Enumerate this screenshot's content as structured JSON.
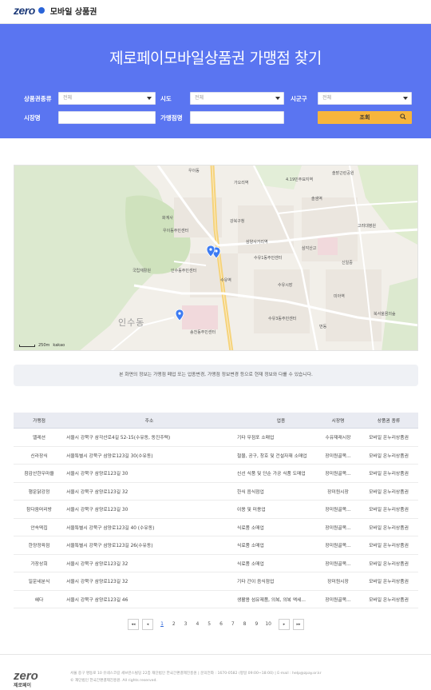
{
  "header": {
    "logo_mark": "zero",
    "logo_text": "모바일 상품권"
  },
  "hero": {
    "title": "제로페이모바일상품권 가맹점 찾기",
    "filters": {
      "voucher_type_label": "상품권종류",
      "voucher_type_value": "전체",
      "sido_label": "시도",
      "sido_value": "전체",
      "sigungu_label": "시군구",
      "sigungu_value": "전체",
      "market_label": "시장명",
      "market_value": "",
      "store_label": "가맹점명",
      "store_value": "",
      "search_label": "조회"
    }
  },
  "map": {
    "district_label": "인수동",
    "scale_label": "250m",
    "provider": "kakao",
    "labels": [
      "우이동",
      "가오리역",
      "4.19민주묘지역",
      "솔밭근린공원",
      "솔샘역",
      "우이동주민센터",
      "수유1동주민센터",
      "수유3동주민센터",
      "삼양사거리역",
      "수유역",
      "미아역",
      "인수동주민센터",
      "송천동주민센터",
      "번동",
      "강북구청",
      "수유시장",
      "고려대병원",
      "삼각산고",
      "신일중",
      "국립재활원",
      "화계사",
      "북서울꿈의숲"
    ]
  },
  "notice": "본 화면의 정보는 가맹점 폐업 또는 업종변경, 가맹점 정보변경 등으로 현재 정보와 다를 수 있습니다.",
  "table": {
    "headers": [
      "가맹점",
      "주소",
      "업종",
      "시장명",
      "상품권 종류"
    ],
    "rows": [
      [
        "엘레션",
        "서울시 강북구 삼각산로4길 52-15(수유동, 동진주택)",
        "기타 무점포 소매업",
        "수유재래시장",
        "모바일 온누리상품권"
      ],
      [
        "신라장식",
        "서울특별시 강북구 삼양로123길 30(수유동)",
        "철물, 공구, 창호 및 건설자재 소매업",
        "장미원골목...",
        "모바일 온누리상품권"
      ],
      [
        "참감산한우마을",
        "서울시 강북구 삼양로123길 30",
        "신선 식품 및 단순 가공 식품 도매업",
        "장미원골목...",
        "모바일 온누리상품권"
      ],
      [
        "행운닭강정",
        "서울시 강북구 삼양로123길 32",
        "한식 음식점업",
        "장미원시장",
        "모바일 온누리상품권"
      ],
      [
        "참다움머리방",
        "서울시 강북구 삼양로123길 30",
        "이용 및 미용업",
        "장미원골목...",
        "모바일 온누리상품권"
      ],
      [
        "안속떡집",
        "서울특별시 강북구 삼양로123길 40 (수유동)",
        "식료품 소매업",
        "장미원골목...",
        "모바일 온누리상품권"
      ],
      [
        "한양정육점",
        "서울특별시 강북구 삼양로123길 26(수유동)",
        "식료품 소매업",
        "장미원골목...",
        "모바일 온누리상품권"
      ],
      [
        "가장상회",
        "서울시 강북구 삼양로123길 32",
        "식료품 소매업",
        "장미원골목...",
        "모바일 온누리상품권"
      ],
      [
        "일운네분식",
        "서울시 강북구 삼양로123길 32",
        "기타 간이 음식점업",
        "장미원시장",
        "모바일 온누리상품권"
      ],
      [
        "혜다",
        "서울시 강북구 삼양로123길 46",
        "생활용 섬유제품, 의복, 의복 액세...",
        "장미원골목...",
        "모바일 온누리상품권"
      ]
    ]
  },
  "pagination": {
    "first": "◂◂",
    "prev": "◂",
    "next": "▸",
    "last": "▸▸",
    "pages": [
      "1",
      "2",
      "3",
      "4",
      "5",
      "6",
      "7",
      "8",
      "9",
      "10"
    ],
    "current": "1"
  },
  "footer": {
    "logo_mark": "zero",
    "logo_sub": "제로페이",
    "info_line1": "서울 중구 명동로 10 유네스코길 세브란스빌딩 22층 재단법인 한국간편결제진흥원  |  문의전화 : 1670-0582 (평일 09:00~18:00)  |  E-mail : help@zpay.or.kr",
    "info_line2": "© 재단법인 한국간편결제진흥원. All rights reserved."
  },
  "colors": {
    "hero_bg": "#5a75f1",
    "search_btn": "#f7b53c",
    "brand": "#1f3c7a",
    "marker": "#3d7bf2"
  },
  "icons": {
    "search": "search-icon",
    "marker": "map-marker-icon",
    "caret": "chevron-down-icon"
  }
}
